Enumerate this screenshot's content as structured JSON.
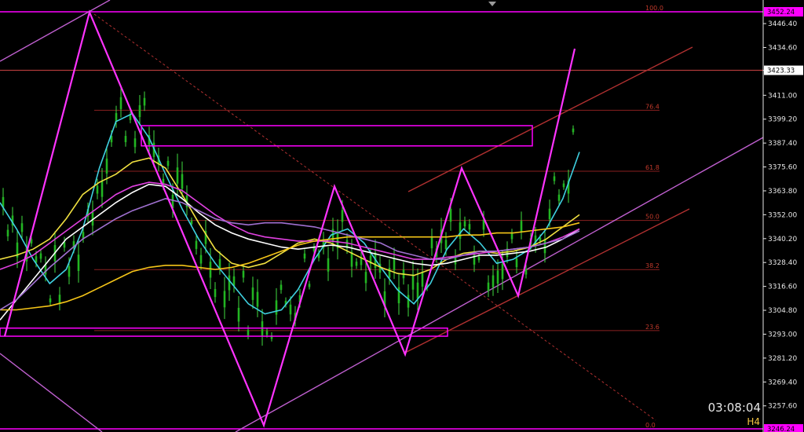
{
  "chart_data": {
    "type": "line",
    "timeframe": "H4",
    "countdown": "03:08:04",
    "grid": false,
    "y_axis": {
      "ylim": [
        3246.24,
        3458.0
      ],
      "ticks": [
        "3446.40",
        "3434.60",
        "3423.33",
        "3411.00",
        "3399.20",
        "3387.40",
        "3375.60",
        "3363.80",
        "3352.00",
        "3340.20",
        "3328.40",
        "3316.60",
        "3304.80",
        "3293.00",
        "3281.20",
        "3269.40",
        "3257.60"
      ],
      "tick_values": [
        3446.4,
        3434.6,
        3423.33,
        3411.0,
        3399.2,
        3387.4,
        3375.6,
        3363.8,
        3352.0,
        3340.2,
        3328.4,
        3316.6,
        3304.8,
        3293.0,
        3281.2,
        3269.4,
        3257.6
      ]
    },
    "price_lines": [
      {
        "label": "3452.24",
        "value": 3452.24,
        "color": "#ff00ff"
      },
      {
        "label": "3423.33",
        "value": 3423.33,
        "color": "#b03a3a"
      },
      {
        "label": "3246.24",
        "value": 3246.24,
        "color": "#ff00ff"
      }
    ],
    "fibonacci": [
      {
        "label": "100.0",
        "value": 3452.24
      },
      {
        "label": "76.4",
        "value": 3403.6
      },
      {
        "label": "61.8",
        "value": 3373.5
      },
      {
        "label": "50.0",
        "value": 3349.2
      },
      {
        "label": "38.2",
        "value": 3324.9
      },
      {
        "label": "23.6",
        "value": 3294.8
      },
      {
        "label": "0.0",
        "value": 3246.24
      }
    ],
    "zigzag": {
      "color": "#ff33ff",
      "points": [
        [
          0,
          3292
        ],
        [
          18,
          3452
        ],
        [
          55,
          3248
        ],
        [
          70,
          3366
        ],
        [
          85,
          3283
        ],
        [
          97,
          3375
        ],
        [
          109,
          3312
        ],
        [
          121,
          3434
        ]
      ]
    },
    "rectangles": [
      {
        "x0": 30,
        "x1": 113,
        "y0": 3386,
        "y1": 3396,
        "color": "#ff00ff"
      },
      {
        "x0": 0,
        "x1": 95,
        "y0": 3292,
        "y1": 3296,
        "color": "#ff00ff"
      }
    ],
    "series": [
      {
        "color": "#3fd0e0",
        "values": [
          3358,
          3345,
          3330,
          3318,
          3325,
          3345,
          3375,
          3398,
          3402,
          3390,
          3372,
          3355,
          3340,
          3328,
          3318,
          3308,
          3303,
          3305,
          3315,
          3330,
          3342,
          3345,
          3338,
          3326,
          3315,
          3308,
          3318,
          3335,
          3345,
          3338,
          3328,
          3330,
          3335,
          3345,
          3360,
          3383
        ]
      },
      {
        "color": "#f0e040",
        "values": [
          3330,
          3332,
          3335,
          3340,
          3350,
          3362,
          3368,
          3372,
          3378,
          3380,
          3375,
          3362,
          3348,
          3335,
          3328,
          3326,
          3328,
          3333,
          3338,
          3340,
          3338,
          3334,
          3330,
          3326,
          3323,
          3322,
          3325,
          3330,
          3333,
          3334,
          3333,
          3334,
          3336,
          3340,
          3346,
          3352
        ]
      },
      {
        "color": "#ffffff",
        "values": [
          3300,
          3310,
          3320,
          3330,
          3340,
          3346,
          3352,
          3358,
          3363,
          3367,
          3366,
          3360,
          3353,
          3347,
          3343,
          3340,
          3338,
          3336,
          3335,
          3336,
          3337,
          3336,
          3334,
          3332,
          3330,
          3328,
          3327,
          3328,
          3330,
          3332,
          3332,
          3333,
          3334,
          3336,
          3340,
          3345
        ]
      },
      {
        "color": "#e040e0",
        "values": [
          3325,
          3328,
          3332,
          3338,
          3344,
          3350,
          3356,
          3362,
          3366,
          3368,
          3367,
          3364,
          3358,
          3352,
          3347,
          3343,
          3341,
          3340,
          3339,
          3339,
          3339,
          3338,
          3336,
          3334,
          3332,
          3330,
          3330,
          3331,
          3332,
          3333,
          3334,
          3335,
          3336,
          3338,
          3341,
          3345
        ]
      },
      {
        "color": "#f5c518",
        "values": [
          3305,
          3305,
          3306,
          3307,
          3309,
          3312,
          3316,
          3320,
          3324,
          3326,
          3327,
          3327,
          3326,
          3325,
          3326,
          3328,
          3331,
          3334,
          3337,
          3339,
          3340,
          3341,
          3341,
          3341,
          3341,
          3341,
          3341,
          3341,
          3342,
          3342,
          3343,
          3343,
          3344,
          3345,
          3346,
          3348
        ]
      },
      {
        "color": "#a070d0",
        "values": [
          3305,
          3310,
          3318,
          3326,
          3333,
          3340,
          3345,
          3350,
          3354,
          3357,
          3360,
          3358,
          3354,
          3350,
          3348,
          3347,
          3348,
          3348,
          3347,
          3346,
          3344,
          3342,
          3340,
          3338,
          3334,
          3332,
          3330,
          3330,
          3332,
          3334,
          3334,
          3335,
          3336,
          3338,
          3340,
          3344
        ]
      }
    ]
  }
}
